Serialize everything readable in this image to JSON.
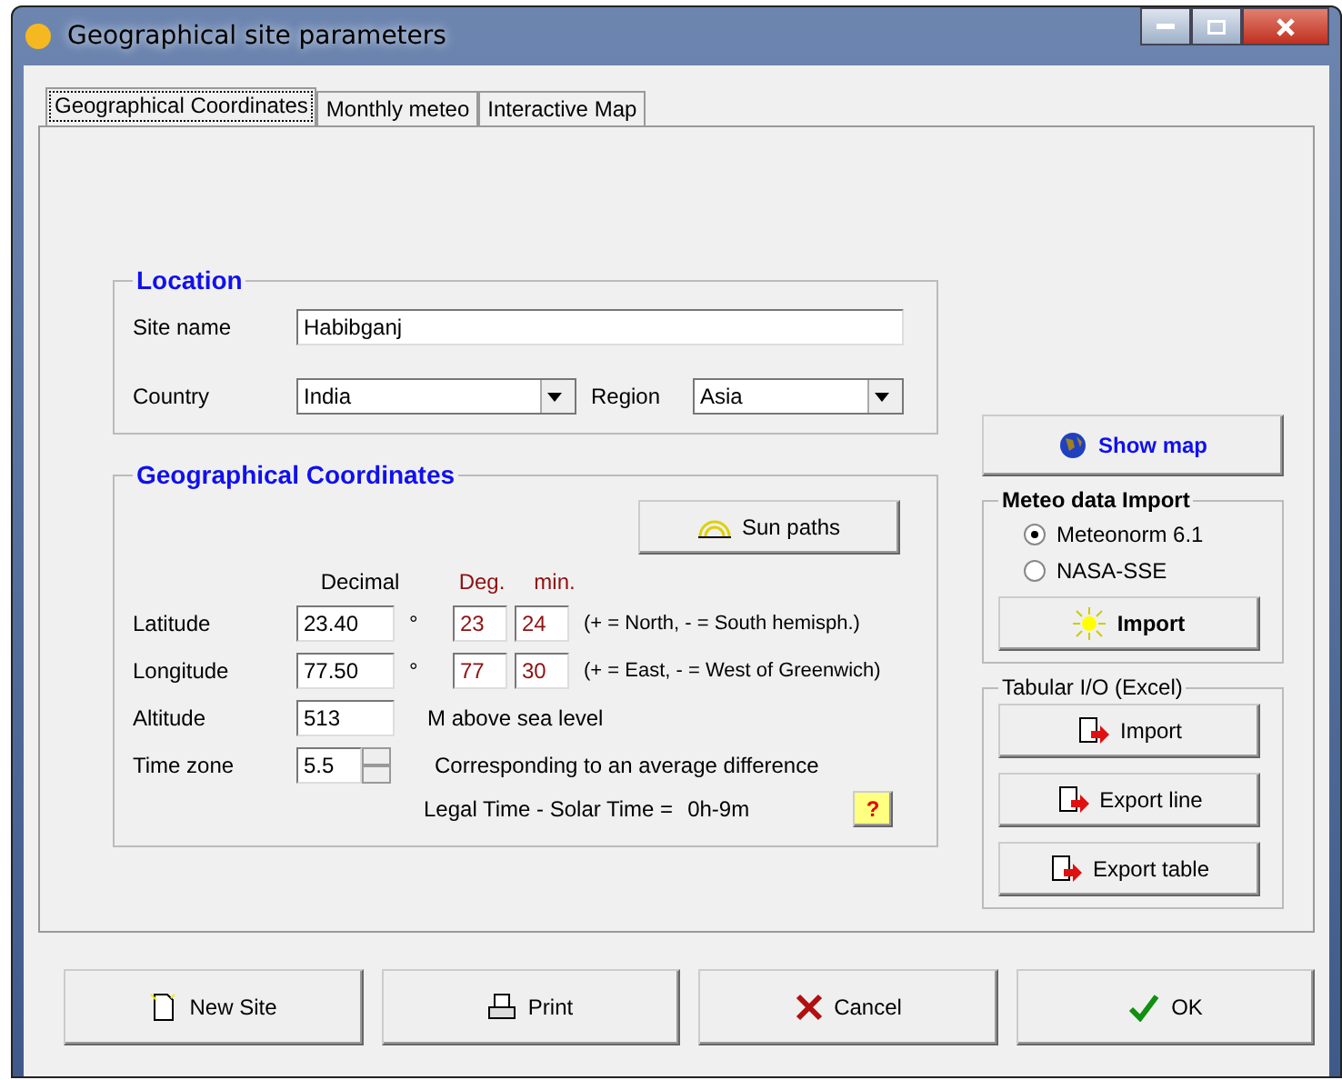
{
  "window": {
    "title": "Geographical site parameters"
  },
  "tabs": [
    {
      "label": "Geographical Coordinates",
      "selected": true
    },
    {
      "label": "Monthly meteo",
      "selected": false
    },
    {
      "label": "Interactive Map",
      "selected": false
    }
  ],
  "location": {
    "title": "Location",
    "site_name": {
      "label": "Site name",
      "value": "Habibganj"
    },
    "country": {
      "label": "Country",
      "value": "India"
    },
    "region": {
      "label": "Region",
      "value": "Asia"
    }
  },
  "coordinates": {
    "title": "Geographical Coordinates",
    "sun_paths": "Sun paths",
    "decimal_header": "Decimal",
    "deg_header": "Deg.",
    "min_header": "min.",
    "rows": [
      {
        "label": "Latitude",
        "decimal": "23.40",
        "unit": "°",
        "deg": "23",
        "min": "24",
        "note": "(+ = North, - = South hemisph.)"
      },
      {
        "label": "Longitude",
        "decimal": "77.50",
        "unit": "°",
        "deg": "77",
        "min": "30",
        "note": "(+ = East, - = West of Greenwich)"
      }
    ],
    "altitude": {
      "label": "Altitude",
      "value": "513",
      "note": "M above sea level"
    },
    "time_zone": {
      "label": "Time zone",
      "value": "5.5",
      "note": "Corresponding to an average difference"
    },
    "legal_time": {
      "label": "Legal Time - Solar Time =",
      "value": "0h-9m"
    },
    "help": "?"
  },
  "show_map": "Show map",
  "meteo_import": {
    "title": "Meteo data Import",
    "options": [
      {
        "label": "Meteonorm 6.1",
        "selected": true
      },
      {
        "label": "NASA-SSE",
        "selected": false
      }
    ],
    "button": "Import"
  },
  "tabular": {
    "title": "Tabular I/O (Excel)",
    "buttons": [
      "Import",
      "Export line",
      "Export table"
    ]
  },
  "footer": [
    {
      "kind": "new",
      "label": "New Site"
    },
    {
      "kind": "print",
      "label": "Print"
    },
    {
      "kind": "cancel",
      "label": "Cancel"
    },
    {
      "kind": "ok",
      "label": "OK"
    }
  ]
}
